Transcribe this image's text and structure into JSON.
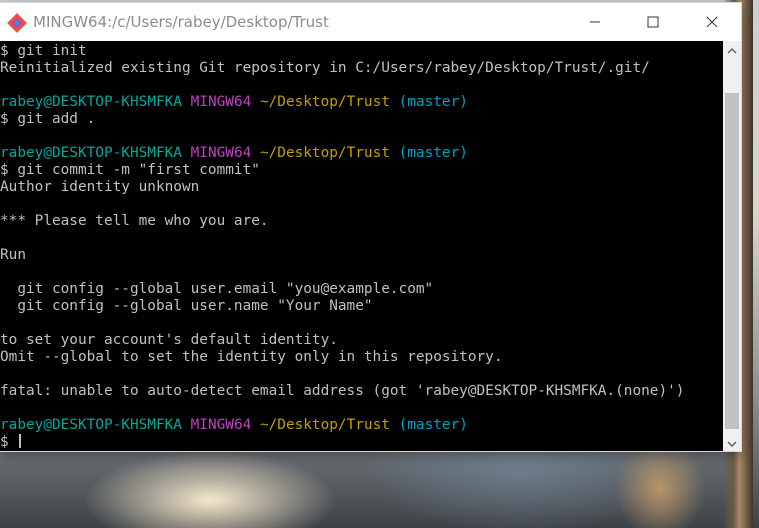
{
  "window": {
    "title": "MINGW64:/c/Users/rabey/Desktop/Trust",
    "app_icon": "git-bash-icon",
    "controls": [
      "minimize-icon",
      "maximize-icon",
      "close-icon"
    ]
  },
  "colors": {
    "terminal_background": "#000000",
    "text_default": "#c0c0c0",
    "prompt_user": "#00a89a",
    "prompt_system": "#bf40bf",
    "prompt_path": "#c0a000",
    "prompt_branch": "#00a0c0"
  },
  "terminal": {
    "lines": [
      [
        {
          "text": "$ git init",
          "color": "white"
        }
      ],
      [
        {
          "text": "Reinitialized existing Git repository in C:/Users/rabey/Desktop/Trust/.git/",
          "color": "white"
        }
      ],
      [],
      [
        {
          "text": "rabey@DESKTOP-KHSMFKA",
          "color": "green"
        },
        {
          "text": " ",
          "color": "white"
        },
        {
          "text": "MINGW64",
          "color": "purple"
        },
        {
          "text": " ",
          "color": "white"
        },
        {
          "text": "~/Desktop/Trust",
          "color": "yellow"
        },
        {
          "text": " ",
          "color": "white"
        },
        {
          "text": "(master)",
          "color": "cyan"
        }
      ],
      [
        {
          "text": "$ git add .",
          "color": "white"
        }
      ],
      [],
      [
        {
          "text": "rabey@DESKTOP-KHSMFKA",
          "color": "green"
        },
        {
          "text": " ",
          "color": "white"
        },
        {
          "text": "MINGW64",
          "color": "purple"
        },
        {
          "text": " ",
          "color": "white"
        },
        {
          "text": "~/Desktop/Trust",
          "color": "yellow"
        },
        {
          "text": " ",
          "color": "white"
        },
        {
          "text": "(master)",
          "color": "cyan"
        }
      ],
      [
        {
          "text": "$ git commit -m \"first commit\"",
          "color": "white"
        }
      ],
      [
        {
          "text": "Author identity unknown",
          "color": "white"
        }
      ],
      [],
      [
        {
          "text": "*** Please tell me who you are.",
          "color": "white"
        }
      ],
      [],
      [
        {
          "text": "Run",
          "color": "white"
        }
      ],
      [],
      [
        {
          "text": "  git config --global user.email \"you@example.com\"",
          "color": "white"
        }
      ],
      [
        {
          "text": "  git config --global user.name \"Your Name\"",
          "color": "white"
        }
      ],
      [],
      [
        {
          "text": "to set your account's default identity.",
          "color": "white"
        }
      ],
      [
        {
          "text": "Omit --global to set the identity only in this repository.",
          "color": "white"
        }
      ],
      [],
      [
        {
          "text": "fatal: unable to auto-detect email address (got 'rabey@DESKTOP-KHSMFKA.(none)')",
          "color": "white"
        }
      ],
      [],
      [
        {
          "text": "rabey@DESKTOP-KHSMFKA",
          "color": "green"
        },
        {
          "text": " ",
          "color": "white"
        },
        {
          "text": "MINGW64",
          "color": "purple"
        },
        {
          "text": " ",
          "color": "white"
        },
        {
          "text": "~/Desktop/Trust",
          "color": "yellow"
        },
        {
          "text": " ",
          "color": "white"
        },
        {
          "text": "(master)",
          "color": "cyan"
        }
      ],
      [
        {
          "text": "$ ",
          "color": "white"
        }
      ]
    ],
    "cursor_line": 23
  }
}
